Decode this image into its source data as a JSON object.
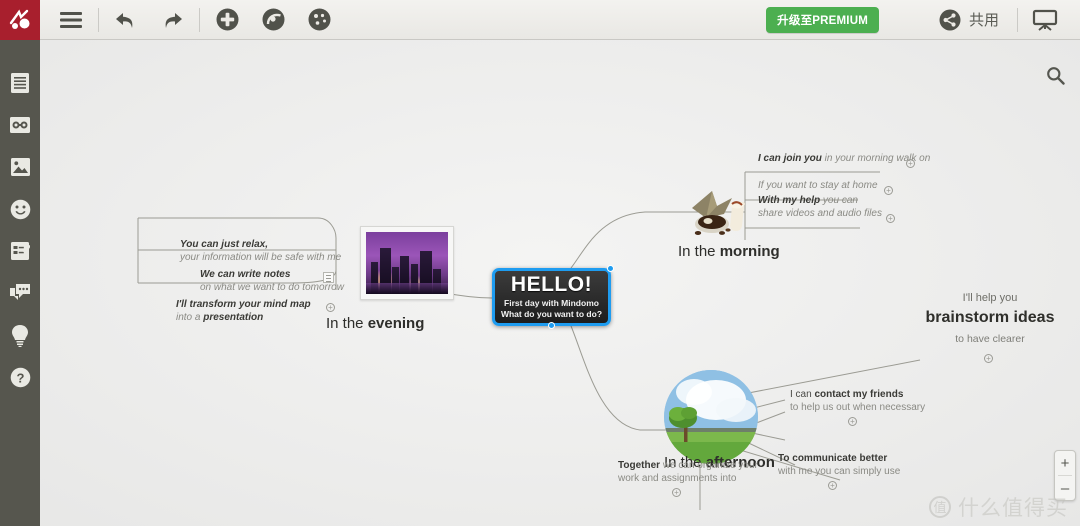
{
  "app": {
    "logo_icon": "mindomo-logo-icon",
    "background_color": "#ececec",
    "accent_color": "#1e9cf0",
    "brand_color": "#a81f2d",
    "premium_color": "#4caf50"
  },
  "toolbar": {
    "menu_icon": "hamburger-menu-icon",
    "undo_icon": "undo-arrow-icon",
    "redo_icon": "redo-arrow-icon",
    "add_icon": "plus-circle-icon",
    "layout_icon": "layout-circle-icon",
    "theme_icon": "palette-circle-icon",
    "premium_label": "升级至PREMIUM",
    "share_icon": "share-circle-icon",
    "share_label": "共用",
    "present_icon": "presentation-screen-icon"
  },
  "sidebar": {
    "items": [
      {
        "icon": "text-notes-icon",
        "name": "sidebar-item-notes"
      },
      {
        "icon": "link-icon",
        "name": "sidebar-item-link"
      },
      {
        "icon": "image-icon",
        "name": "sidebar-item-image"
      },
      {
        "icon": "smiley-icon",
        "name": "sidebar-item-icons"
      },
      {
        "icon": "task-checklist-icon",
        "name": "sidebar-item-task"
      },
      {
        "icon": "comment-bubble-icon",
        "name": "sidebar-item-comment"
      },
      {
        "icon": "lightbulb-icon",
        "name": "sidebar-item-idea"
      },
      {
        "icon": "help-question-icon",
        "name": "sidebar-item-help"
      }
    ]
  },
  "canvas": {
    "search_icon": "search-magnifier-icon",
    "zoom_in_label": "+",
    "zoom_out_label": "–"
  },
  "mindmap": {
    "center": {
      "title": "HELLO!",
      "subtitle_1": "First day with Mindomo",
      "subtitle_2": "What do you want to do?"
    },
    "branches": [
      {
        "id": "evening",
        "label_plain": "In the ",
        "label_bold": "evening",
        "image": "city-skyline-at-dusk-image",
        "children": [
          {
            "bold": "You can just relax,",
            "plain": "your information will be safe with me",
            "has_plus": false,
            "has_note_icon": false
          },
          {
            "bold": "We can write notes",
            "plain": "on what we want to do tomorrow",
            "has_plus": false,
            "has_note_icon": true
          },
          {
            "bold": "I'll transform your mind map",
            "plain": "into a ",
            "plain_bold": "presentation",
            "has_plus": true,
            "has_note_icon": false
          }
        ]
      },
      {
        "id": "morning",
        "label_plain": "In the ",
        "label_bold": "morning",
        "image": "coffee-beans-and-cup-image",
        "children": [
          {
            "bold": "I can join you",
            "plain": " in your morning walk on",
            "has_plus": true
          },
          {
            "bold": "",
            "plain": "If you want to stay at home",
            "has_plus": true
          },
          {
            "bold": "With my help",
            "plain": " you can",
            "plain_2": "share videos and audio files",
            "has_plus": true
          }
        ]
      },
      {
        "id": "afternoon",
        "label_plain": "In the ",
        "label_bold": "afternoon",
        "image": "tree-and-sky-landscape-image",
        "children": [
          {
            "line_1": "I'll help you",
            "line_2": "brainstorm ideas",
            "line_3": "to have clearer",
            "has_plus": true
          },
          {
            "bold_prefix": "I can ",
            "bold": "contact my friends",
            "plain": "to help us out when necessary",
            "has_plus": true
          },
          {
            "bold": "Together",
            "plain": " we can organize your",
            "plain_2": "work and assignments into",
            "has_plus": true
          },
          {
            "bold": "To communicate better",
            "plain": "with me you can simply use",
            "has_plus": true
          }
        ]
      }
    ]
  },
  "watermark": {
    "logo_char": "值",
    "text": "什么值得买"
  }
}
